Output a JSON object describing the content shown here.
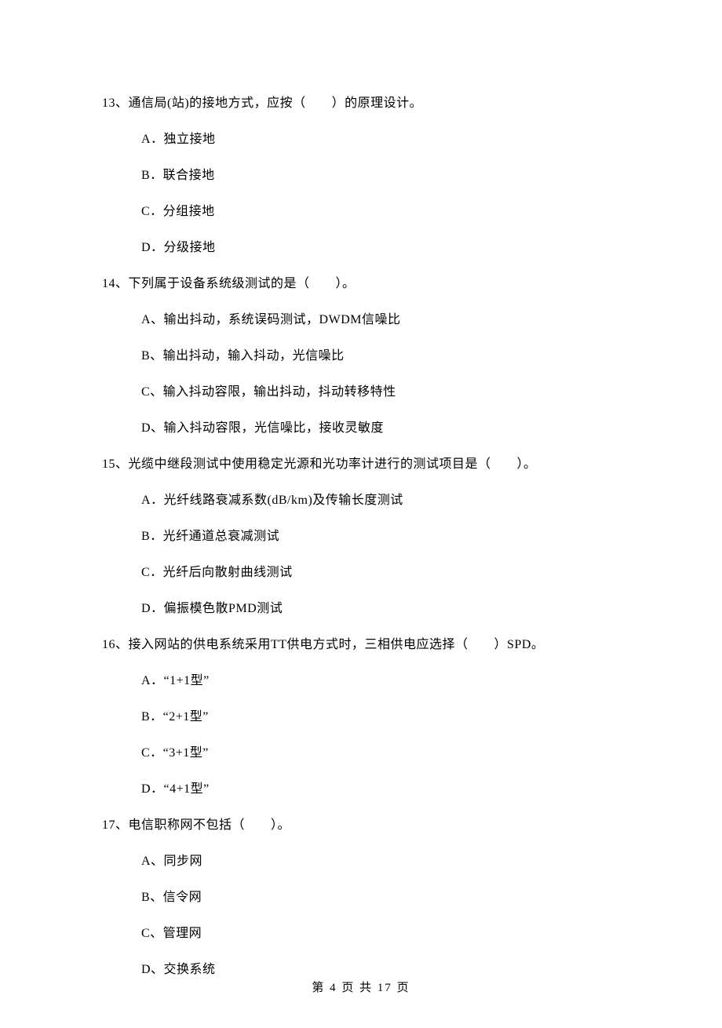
{
  "questions": [
    {
      "stem": "13、通信局(站)的接地方式，应按（　　）的原理设计。",
      "options": [
        "A．独立接地",
        "B．联合接地",
        "C．分组接地",
        "D．分级接地"
      ]
    },
    {
      "stem": "14、下列属于设备系统级测试的是（　　）。",
      "options": [
        "A、输出抖动，系统误码测试，DWDM信噪比",
        "B、输出抖动，输入抖动，光信噪比",
        "C、输入抖动容限，输出抖动，抖动转移特性",
        "D、输入抖动容限，光信噪比，接收灵敏度"
      ]
    },
    {
      "stem": "15、光缆中继段测试中使用稳定光源和光功率计进行的测试项目是（　　）。",
      "options": [
        "A．光纤线路衰减系数(dB/km)及传输长度测试",
        "B．光纤通道总衰减测试",
        "C．光纤后向散射曲线测试",
        "D．偏振模色散PMD测试"
      ]
    },
    {
      "stem": "16、接入网站的供电系统采用TT供电方式时，三相供电应选择（　　）SPD。",
      "options": [
        "A．“1+1型”",
        "B．“2+1型”",
        "C．“3+1型”",
        "D．“4+1型”"
      ]
    },
    {
      "stem": "17、电信职称网不包括（　　）。",
      "options": [
        "A、同步网",
        "B、信令网",
        "C、管理网",
        "D、交换系统"
      ]
    }
  ],
  "footer": "第 4 页 共 17 页"
}
